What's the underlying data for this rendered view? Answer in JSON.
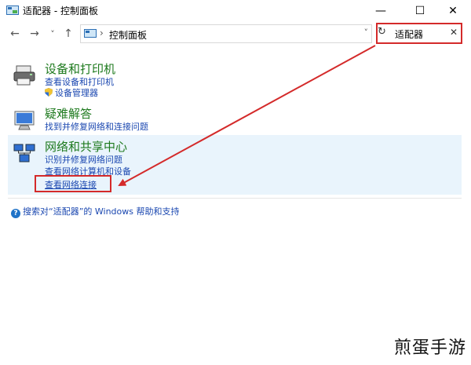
{
  "window": {
    "title": "适配器 - 控制面板",
    "minimize_glyph": "—",
    "maximize_glyph": "☐",
    "close_glyph": "✕"
  },
  "nav": {
    "back_glyph": "←",
    "forward_glyph": "→",
    "recent_glyph": "˅",
    "up_glyph": "↑",
    "separator": "›",
    "breadcrumb": "控制面板",
    "dropdown_glyph": "˅",
    "refresh_glyph": "↻"
  },
  "search": {
    "value": "适配器",
    "clear_glyph": "✕"
  },
  "groups": [
    {
      "icon": "printer-icon",
      "title": "设备和打印机",
      "links": [
        "查看设备和打印机",
        "设备管理器"
      ]
    },
    {
      "icon": "troubleshoot-icon",
      "title": "疑难解答",
      "links": [
        "找到并修复网络和连接问题"
      ]
    },
    {
      "icon": "network-center-icon",
      "title": "网络和共享中心",
      "links": [
        "识别并修复网络问题",
        "查看网络计算机和设备",
        "查看网络连接"
      ]
    }
  ],
  "help": {
    "icon_glyph": "?",
    "text": "搜索对“适配器”的 Windows 帮助和支持"
  },
  "watermark": "煎蛋手游",
  "colors": {
    "link": "#1a47b0",
    "group_title": "#1e7a1e",
    "highlight_box": "#d42a2a",
    "selected_band": "#e9f4fc"
  }
}
